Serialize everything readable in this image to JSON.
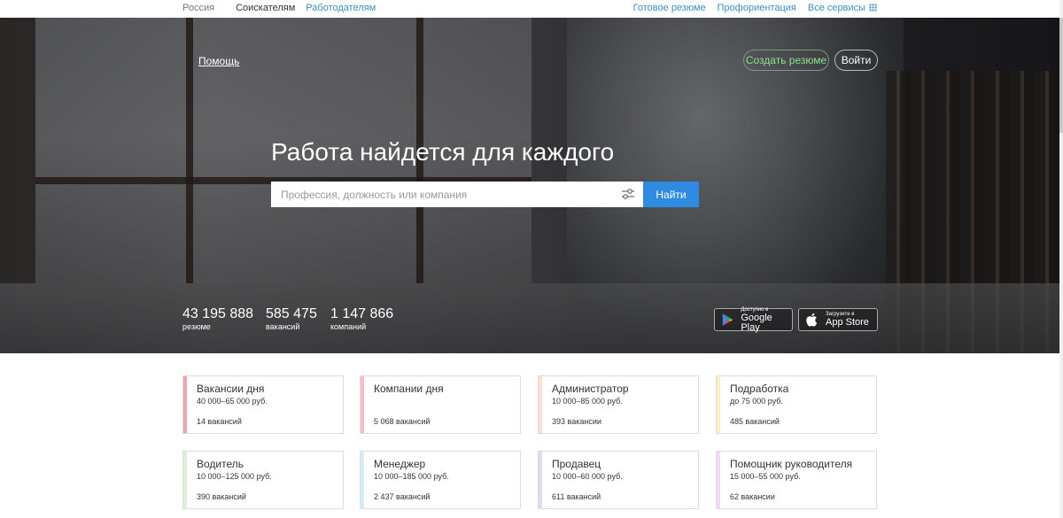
{
  "topbar": {
    "region": "Россия",
    "seekers": "Соискателям",
    "employers": "Работодателям",
    "ready_resume": "Готовое резюме",
    "career": "Профориентация",
    "all_services": "Все сервисы"
  },
  "hero": {
    "help": "Помощь",
    "create_resume": "Создать резюме",
    "login": "Войти",
    "headline": "Работа найдется для каждого",
    "search_placeholder": "Профессия, должность или компания",
    "find": "Найти",
    "stats": [
      {
        "value": "43 195 888",
        "label": "резюме"
      },
      {
        "value": "585 475",
        "label": "вакансий"
      },
      {
        "value": "1 147 866",
        "label": "компаний"
      }
    ],
    "google_play": {
      "small": "Доступно в",
      "big": "Google Play"
    },
    "app_store": {
      "small": "Загрузите в",
      "big": "App Store"
    }
  },
  "cards": [
    {
      "title": "Вакансии дня",
      "salary": "40 000–65 000 руб.",
      "count": "14 вакансий",
      "color": "#f4a4ad"
    },
    {
      "title": "Компании дня",
      "salary": "",
      "count": "5 068 вакансий",
      "color": "#f9bcc6"
    },
    {
      "title": "Администратор",
      "salary": "10 000–85 000 руб.",
      "count": "393 вакансии",
      "color": "#fde0cf"
    },
    {
      "title": "Подработка",
      "salary": "до 75 000 руб.",
      "count": "485 вакансий",
      "color": "#fdf0c4"
    },
    {
      "title": "Водитель",
      "salary": "10 000–125 000 руб.",
      "count": "390 вакансий",
      "color": "#d7f5cf"
    },
    {
      "title": "Менеджер",
      "salary": "10 000–185 000 руб.",
      "count": "2 437 вакансий",
      "color": "#d3eef9"
    },
    {
      "title": "Продавец",
      "salary": "10 000–60 000 руб.",
      "count": "611 вакансий",
      "color": "#dcdcf7"
    },
    {
      "title": "Помощник руководителя",
      "salary": "15 000–55 000 руб.",
      "count": "62 вакансии",
      "color": "#f5d8f3"
    }
  ]
}
